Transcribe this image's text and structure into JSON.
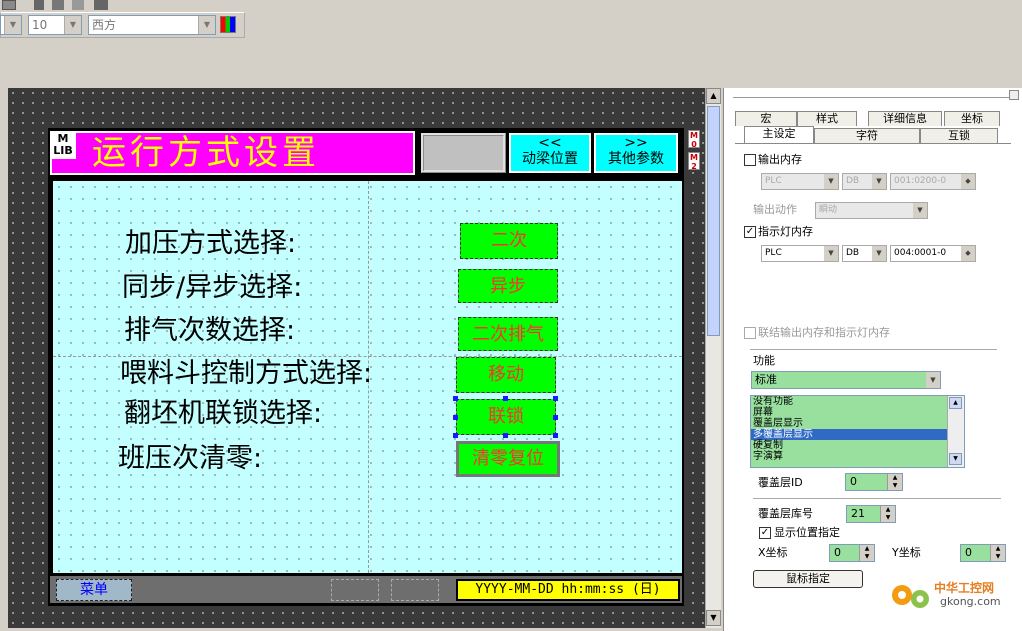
{
  "toolbar": {
    "font_size": "10",
    "font_name": "西方"
  },
  "hmi": {
    "logo_text": "M LIB",
    "title": "运行方式设置",
    "btn_blank": "",
    "btn_prev_arrows": "<<",
    "btn_prev_label": "动梁位置",
    "btn_next_arrows": ">>",
    "btn_next_label": "其他参数",
    "rows": [
      {
        "label": "加压方式选择:",
        "value": "二次"
      },
      {
        "label": "同步/异步选择:",
        "value": "异步"
      },
      {
        "label": "排气次数选择:",
        "value": "二次排气"
      },
      {
        "label": "喂料斗控制方式选择:",
        "value": "移动"
      },
      {
        "label": "翻坯机联锁选择:",
        "value": "联锁"
      },
      {
        "label": "班压次清零:",
        "value": "清零复位"
      }
    ],
    "menu_label": "菜单",
    "datetime_format": "YYYY-MM-DD hh:mm:ss (日)",
    "mini_m1": "M 0",
    "mini_m2": "M 2"
  },
  "panel": {
    "tabs_row1": [
      "宏",
      "样式",
      "详细信息",
      "坐标"
    ],
    "tabs_row2": [
      "主设定",
      "字符",
      "互锁"
    ],
    "output_mem_label": "输出内存",
    "output_mem_dev": "PLC",
    "output_mem_type": "DB",
    "output_mem_addr": "001:0200-0",
    "output_action_label": "输出动作",
    "output_action_value": "瞬动",
    "indicator_label": "指示灯内存",
    "indicator_checked": "✓",
    "indicator_dev": "PLC",
    "indicator_type": "DB",
    "indicator_addr": "004:0001-0",
    "link_label": "联结输出内存和指示灯内存",
    "function_label": "功能",
    "function_value": "标准",
    "function_list": [
      "没有功能",
      "屏幕",
      "覆盖层显示",
      "多覆盖层显示",
      "硬复制",
      "字演算"
    ],
    "function_selected": "多覆盖层显示",
    "overlay_id_label": "覆盖层ID",
    "overlay_id_value": "0",
    "overlay_lib_label": "覆盖层库号",
    "overlay_lib_value": "21",
    "show_pos_label": "显示位置指定",
    "show_pos_checked": "✓",
    "x_label": "X坐标",
    "x_value": "0",
    "y_label": "Y坐标",
    "y_value": "0",
    "mouse_btn": "鼠标指定"
  },
  "watermark": {
    "title": "中华工控网",
    "url": "gkong.com"
  },
  "colors": {
    "title_bg": "#ff00ff",
    "title_fg": "#ffff00",
    "panel_bg": "#c4ffff",
    "button_bg": "#00ff00",
    "button_fg": "#ff3030",
    "nav_bg": "#00ffff",
    "field_bg": "#99e09f"
  }
}
